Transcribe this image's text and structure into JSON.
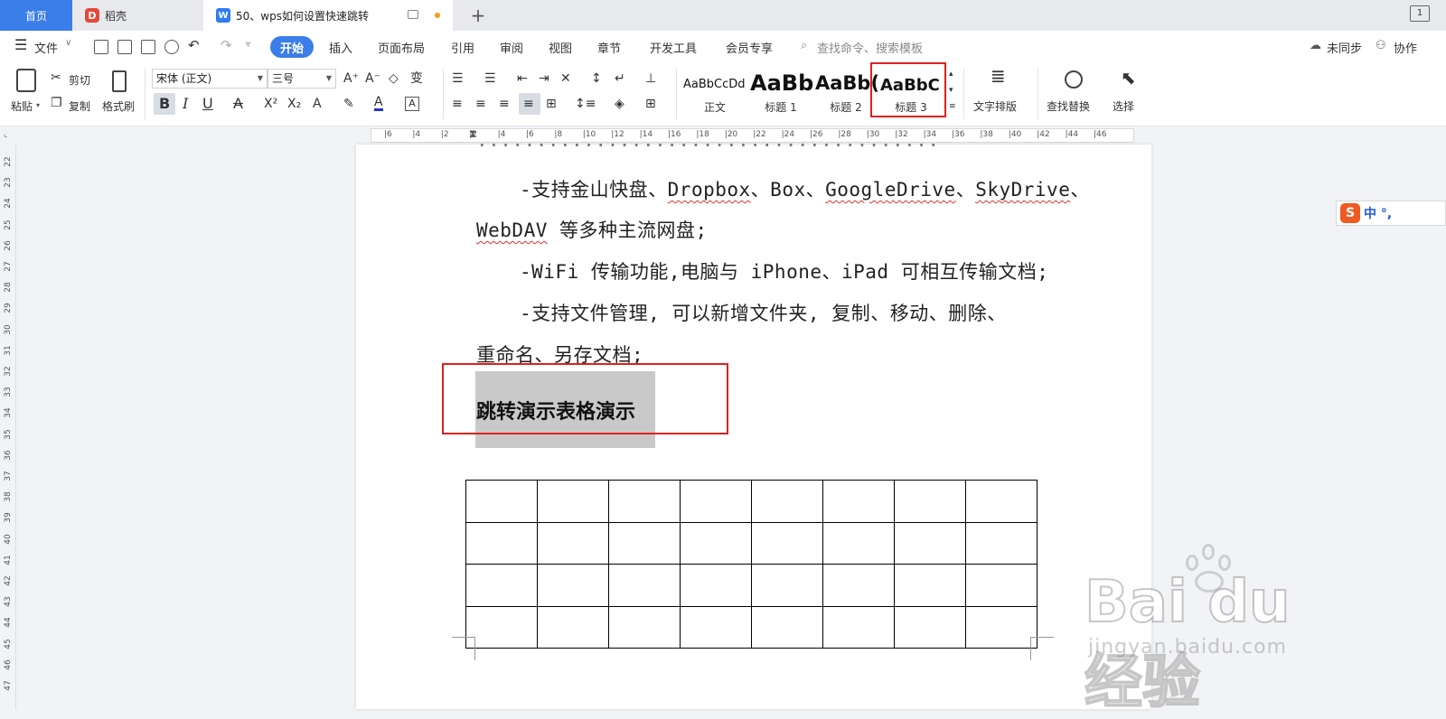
{
  "tabs": {
    "home": "首页",
    "daoke": "稻壳",
    "document": "50、wps如何设置快速跳转",
    "add": "+",
    "window_count": "1"
  },
  "menu": {
    "file": "文件",
    "items": [
      "开始",
      "插入",
      "页面布局",
      "引用",
      "审阅",
      "视图",
      "章节",
      "开发工具",
      "会员专享"
    ],
    "search_placeholder": "查找命令、搜索模板",
    "sync": "未同步",
    "collab": "协作"
  },
  "ribbon": {
    "paste": "粘贴",
    "cut": "剪切",
    "copy": "复制",
    "format_painter": "格式刷",
    "font_name": "宋体 (正文)",
    "font_size": "三号",
    "styles": [
      {
        "sample": "AaBbCcDd",
        "name": "正文"
      },
      {
        "sample": "AaBb",
        "name": "标题 1"
      },
      {
        "sample": "AaBb(",
        "name": "标题 2"
      },
      {
        "sample": "AaBbC",
        "name": "标题 3"
      }
    ],
    "text_layout": "文字排版",
    "find_replace": "查找替换",
    "select": "选择"
  },
  "ruler": {
    "ticks": [
      "6",
      "4",
      "2",
      "2",
      "4",
      "6",
      "8",
      "10",
      "12",
      "14",
      "16",
      "18",
      "20",
      "22",
      "24",
      "26",
      "28",
      "30",
      "32",
      "34",
      "36",
      "38",
      "40",
      "42",
      "44",
      "46"
    ],
    "line_numbers": [
      "22",
      "23",
      "24",
      "25",
      "26",
      "27",
      "28",
      "29",
      "30",
      "31",
      "32",
      "33",
      "34",
      "35",
      "36",
      "37",
      "38",
      "39",
      "40",
      "41",
      "42",
      "43",
      "44",
      "45",
      "46",
      "47"
    ]
  },
  "document": {
    "line1a": "-支持金山快盘、",
    "line1b": "Dropbox",
    "line1c": "、Box、",
    "line1d": "GoogleDrive",
    "line1e": "、",
    "line1f": "SkyDrive",
    "line1g": "、",
    "line2a": "WebDAV",
    "line2b": " 等多种主流网盘;",
    "line3": "-WiFi 传输功能,电脑与 iPhone、iPad 可相互传输文档;",
    "line4": "-支持文件管理, 可以新增文件夹, 复制、移动、删除、",
    "line5": "重命名、另存文档;",
    "heading": "跳转演示表格演示",
    "table_rows": 4,
    "table_cols": 8
  },
  "ime": {
    "logo": "S",
    "text": "中 °,"
  },
  "watermark": {
    "big": "Bai du 经验",
    "small": "jingyan.baidu.com"
  },
  "colors": {
    "accent": "#3b7de9",
    "highlight_box": "#e0201e",
    "selection": "#c9c9c9"
  }
}
